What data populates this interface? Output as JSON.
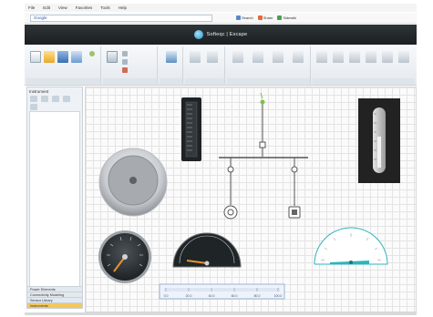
{
  "menu": [
    "File",
    "Edit",
    "View",
    "Favorites",
    "Tools",
    "Help"
  ],
  "address": {
    "value": "Google"
  },
  "ie_tools": [
    "Search",
    "Share",
    "Sidewiki"
  ],
  "app": {
    "title": "Softeqc | Escape"
  },
  "panel": {
    "title": "Instrument",
    "tabs": [
      {
        "label": "Power Elements",
        "active": false
      },
      {
        "label": "Connectivity Modeling",
        "active": false
      },
      {
        "label": "Sensor Library",
        "active": false
      },
      {
        "label": "Instruments",
        "active": true
      }
    ]
  },
  "linear_scale": {
    "tick_labels": [
      "0.0",
      "20.0",
      "40.0",
      "60.0",
      "80.0",
      "100.0"
    ]
  },
  "colors": {
    "title_band": "#232829",
    "active_tab": "#f3c85c",
    "gauge_needle": "#e8932c",
    "accent_teal": "#2fb3bd",
    "breaker_indicator": "#7ec242"
  }
}
